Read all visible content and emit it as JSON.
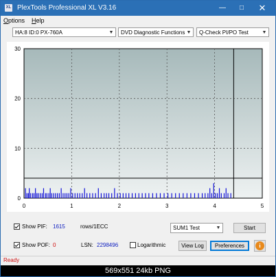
{
  "window": {
    "title": "PlexTools Professional XL V3.16",
    "app_icon_text": "XL",
    "minimize_icon": "minimize-icon",
    "maximize_icon": "maximize-icon",
    "close_icon": "close-icon"
  },
  "menu": {
    "options": "Options",
    "help": "Help"
  },
  "toolbar": {
    "drive": "HA:8 ID:0  PX-760A",
    "function": "DVD Diagnostic Functions",
    "test": "Q-Check PI/PO Test"
  },
  "chart_data": {
    "type": "bar",
    "title": "",
    "xlabel": "",
    "ylabel": "",
    "xlim": [
      0,
      5
    ],
    "ylim": [
      0,
      30
    ],
    "x_ticks": [
      "0",
      "1",
      "2",
      "3",
      "4",
      "5"
    ],
    "y_ticks": [
      "0",
      "10",
      "20",
      "30"
    ],
    "grid": true,
    "threshold_value": 4,
    "end_marker_x": 4.4,
    "colors": {
      "bars": "#1010d8",
      "threshold": "#000000",
      "plot_bg_top": "#a6b9ba",
      "plot_bg_bottom": "#eef2f2"
    },
    "series": [
      {
        "values": [
          [
            0.03,
            2
          ],
          [
            0.06,
            1
          ],
          [
            0.09,
            1
          ],
          [
            0.11,
            2
          ],
          [
            0.14,
            1
          ],
          [
            0.18,
            1
          ],
          [
            0.21,
            1
          ],
          [
            0.24,
            2
          ],
          [
            0.27,
            1
          ],
          [
            0.3,
            1
          ],
          [
            0.34,
            1
          ],
          [
            0.38,
            1
          ],
          [
            0.41,
            2
          ],
          [
            0.45,
            1
          ],
          [
            0.48,
            1
          ],
          [
            0.52,
            1
          ],
          [
            0.55,
            2
          ],
          [
            0.58,
            1
          ],
          [
            0.62,
            1
          ],
          [
            0.66,
            1
          ],
          [
            0.7,
            1
          ],
          [
            0.74,
            1
          ],
          [
            0.78,
            2
          ],
          [
            0.82,
            1
          ],
          [
            0.86,
            1
          ],
          [
            0.9,
            1
          ],
          [
            0.94,
            1
          ],
          [
            0.98,
            2
          ],
          [
            1.02,
            1
          ],
          [
            1.07,
            1
          ],
          [
            1.12,
            1
          ],
          [
            1.17,
            1
          ],
          [
            1.22,
            1
          ],
          [
            1.27,
            2
          ],
          [
            1.32,
            1
          ],
          [
            1.38,
            1
          ],
          [
            1.44,
            1
          ],
          [
            1.5,
            1
          ],
          [
            1.56,
            2
          ],
          [
            1.62,
            1
          ],
          [
            1.68,
            1
          ],
          [
            1.73,
            1
          ],
          [
            1.78,
            1
          ],
          [
            1.84,
            1
          ],
          [
            1.9,
            2
          ],
          [
            1.96,
            1
          ],
          [
            2.02,
            1
          ],
          [
            2.08,
            1
          ],
          [
            2.14,
            1
          ],
          [
            2.2,
            1
          ],
          [
            2.27,
            1
          ],
          [
            2.34,
            1
          ],
          [
            2.41,
            1
          ],
          [
            2.48,
            1
          ],
          [
            2.55,
            1
          ],
          [
            2.62,
            1
          ],
          [
            2.7,
            1
          ],
          [
            2.78,
            1
          ],
          [
            2.86,
            1
          ],
          [
            2.94,
            1
          ],
          [
            3.02,
            1
          ],
          [
            3.1,
            1
          ],
          [
            3.18,
            1
          ],
          [
            3.26,
            1
          ],
          [
            3.34,
            1
          ],
          [
            3.42,
            1
          ],
          [
            3.5,
            1
          ],
          [
            3.58,
            1
          ],
          [
            3.66,
            1
          ],
          [
            3.74,
            1
          ],
          [
            3.8,
            1
          ],
          [
            3.86,
            1
          ],
          [
            3.9,
            2
          ],
          [
            3.94,
            1
          ],
          [
            3.98,
            3
          ],
          [
            4.02,
            1
          ],
          [
            4.06,
            1
          ],
          [
            4.1,
            2
          ],
          [
            4.14,
            1
          ],
          [
            4.2,
            1
          ],
          [
            4.24,
            2
          ],
          [
            4.28,
            1
          ],
          [
            4.34,
            1
          ]
        ]
      }
    ]
  },
  "stats": {
    "show_pif_label": "Show PIF:",
    "pif_value": "1615",
    "rows_label": "rows/1ECC",
    "show_pof_label": "Show POF:",
    "pof_value": "0",
    "lsn_label": "LSN:",
    "lsn_value": "2298496",
    "logarithmic_label": "Logarithmic",
    "sum_mode": "SUM1 Test"
  },
  "buttons": {
    "start": "Start",
    "view_log": "View Log",
    "preferences": "Preferences",
    "info_icon": "info-icon"
  },
  "status": {
    "text": "Ready"
  },
  "caption": {
    "text": "569x551  24kb  PNG"
  }
}
